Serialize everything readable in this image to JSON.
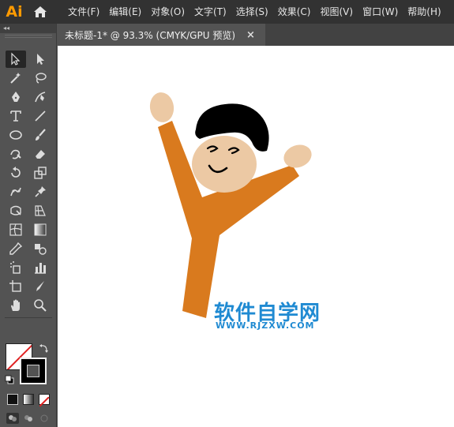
{
  "app": {
    "logo_text": "Ai",
    "accent": "#ff9a00"
  },
  "menu": {
    "items": [
      {
        "label": "文件(F)"
      },
      {
        "label": "编辑(E)"
      },
      {
        "label": "对象(O)"
      },
      {
        "label": "文字(T)"
      },
      {
        "label": "选择(S)"
      },
      {
        "label": "效果(C)"
      },
      {
        "label": "视图(V)"
      },
      {
        "label": "窗口(W)"
      },
      {
        "label": "帮助(H)"
      }
    ]
  },
  "document": {
    "tab_title": "未标题-1* @ 93.3% (CMYK/GPU 预览)",
    "close_glyph": "×"
  },
  "toolbar": {
    "collapse_glyph": "◂◂",
    "tools": [
      "selection-tool",
      "direct-selection-tool",
      "magic-wand-tool",
      "lasso-tool",
      "pen-tool",
      "curvature-tool",
      "type-tool",
      "line-segment-tool",
      "ellipse-tool",
      "paintbrush-tool",
      "shaper-tool",
      "eraser-tool",
      "rotate-tool",
      "scale-tool",
      "puppet-warp-tool",
      "pin-tool",
      "free-transform-tool",
      "perspective-grid-tool",
      "mesh-tool",
      "gradient-tool",
      "eyedropper-tool",
      "blend-tool",
      "symbol-sprayer-tool",
      "column-graph-tool",
      "artboard-tool",
      "slice-tool",
      "hand-tool",
      "zoom-tool"
    ],
    "fill_color": "#ffffff",
    "stroke_color": "#000000"
  },
  "artwork": {
    "body_color": "#d97a1e",
    "skin_color": "#ecc9a4",
    "hair_color": "#000000"
  },
  "watermark": {
    "title": "软件自学网",
    "url": "WWW.RJZXW.COM",
    "color": "#1f8ad2"
  }
}
